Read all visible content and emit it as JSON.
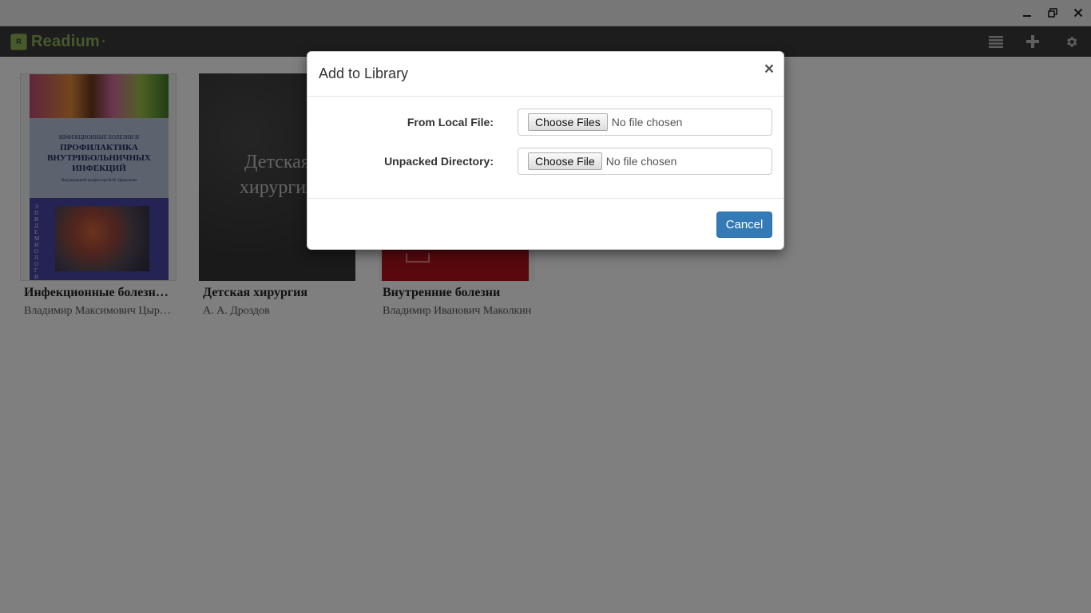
{
  "app": {
    "name": "Readium"
  },
  "window_controls": {
    "minimize": "minimize-icon",
    "maximize": "restore-icon",
    "close": "close-icon"
  },
  "navbar": {
    "icons": [
      "list-view-icon",
      "add-icon",
      "gear-icon"
    ]
  },
  "library": {
    "books": [
      {
        "title": "Инфекционные болезни и профилактика внутрибольничных инфекций",
        "author": "Владимир Максимович Цыркунов",
        "cover": {
          "line1": "ИНФЕКЦИОННЫЕ БОЛЕЗНИ И",
          "line2": "ПРОФИЛАКТИКА",
          "line3": "ВНУТРИБОЛЬНИЧНЫХ",
          "line4": "ИНФЕКЦИЙ",
          "line5": "Под редакцией профессора В.М. Цыркунова",
          "side": "ЭПИДЕМИОЛОГИЯ"
        }
      },
      {
        "title": "Детская хирургия",
        "author": "А. А. Дроздов",
        "cover": {
          "line1": "Детская",
          "line2": "хирургия"
        }
      },
      {
        "title": "Внутренние болезни",
        "author": "Владимир Иванович Маколкин"
      }
    ]
  },
  "modal": {
    "title": "Add to Library",
    "close_label": "×",
    "local_file": {
      "label": "From Local File:",
      "button": "Choose Files",
      "status": "No file chosen"
    },
    "unpacked_dir": {
      "label": "Unpacked Directory:",
      "button": "Choose File",
      "status": "No file chosen"
    },
    "cancel_label": "Cancel"
  },
  "colors": {
    "navbar_bg": "#3b3b3b",
    "brand_green": "#8fb35a",
    "primary_button": "#337ab7"
  }
}
